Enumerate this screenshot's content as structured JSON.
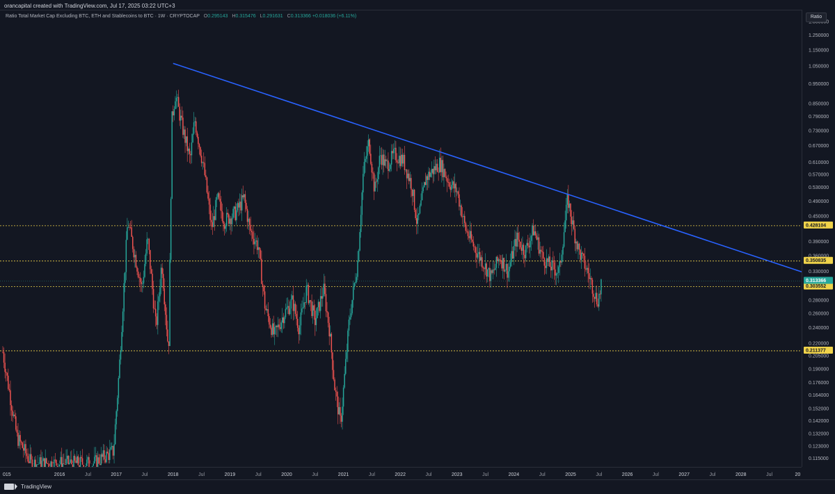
{
  "header": {
    "credit": "orancapital created with TradingView.com, Jul 17, 2025 03:22 UTC+3"
  },
  "legend": {
    "title": "Ratio Total Market Cap Excluding BTC, ETH and Stablecoins to BTC · 1W · CRYPTOCAP",
    "open_label": "O",
    "open": "0.295143",
    "high_label": "H",
    "high": "0.315476",
    "low_label": "L",
    "low": "0.291631",
    "close_label": "C",
    "close": "0.313366",
    "change": "+0.018036 (+6.11%)"
  },
  "price_axis": {
    "scale_button": "Ratio",
    "ticks": [
      "1.350000",
      "1.250000",
      "1.150000",
      "1.050000",
      "0.950000",
      "0.850000",
      "0.790000",
      "0.730000",
      "0.670000",
      "0.610000",
      "0.570000",
      "0.530000",
      "0.490000",
      "0.450000",
      "0.390000",
      "0.360000",
      "0.330000",
      "0.280000",
      "0.260000",
      "0.240000",
      "0.220000",
      "0.205000",
      "0.190000",
      "0.176000",
      "0.164000",
      "0.152000",
      "0.142000",
      "0.132000",
      "0.123000",
      "0.115000"
    ]
  },
  "time_axis": {
    "labels": [
      "015",
      "2016",
      "Jul",
      "2017",
      "Jul",
      "2018",
      "Jul",
      "2019",
      "Jul",
      "2020",
      "Jul",
      "2021",
      "Jul",
      "2022",
      "Jul",
      "2023",
      "Jul",
      "2024",
      "Jul",
      "2025",
      "Jul",
      "2026",
      "Jul",
      "2027",
      "Jul",
      "2028",
      "Jul",
      "20"
    ]
  },
  "footer": {
    "brand": "TradingView"
  },
  "colors": {
    "up": "#26a69a",
    "down": "#ef5350",
    "trendline": "#2962ff",
    "level": "#f0d34a",
    "current": "#26a69a"
  },
  "chart_data": {
    "type": "candlestick",
    "scale": "log",
    "symbol": "Ratio Total Market Cap Excluding BTC, ETH and Stablecoins to BTC",
    "interval": "1W",
    "exchange": "CRYPTOCAP",
    "ylim": [
      0.112,
      1.42
    ],
    "xlim": [
      "2015-01",
      "2029-12"
    ],
    "grid": false,
    "last": {
      "open": 0.295143,
      "high": 0.315476,
      "low": 0.291631,
      "close": 0.313366,
      "change": 0.018036,
      "change_pct": 6.11
    },
    "horizontal_levels": [
      {
        "value": 0.428104,
        "label": "0.428104",
        "style": "dashed"
      },
      {
        "value": 0.350835,
        "label": "0.350835",
        "style": "dashed"
      },
      {
        "value": 0.303552,
        "label": "0.303552",
        "style": "dashed"
      },
      {
        "value": 0.211377,
        "label": "0.211377",
        "style": "dashed"
      }
    ],
    "current_price": {
      "value": 0.313366,
      "label": "0.313366"
    },
    "trendline": {
      "from": {
        "t": 2018.0,
        "y": 1.07
      },
      "to": {
        "t": 2029.6,
        "y": 0.312
      }
    },
    "price_path": [
      [
        2015.0,
        0.21
      ],
      [
        2015.25,
        0.13
      ],
      [
        2015.5,
        0.112
      ],
      [
        2015.8,
        0.112
      ],
      [
        2016.6,
        0.112
      ],
      [
        2016.95,
        0.12
      ],
      [
        2017.05,
        0.19
      ],
      [
        2017.2,
        0.44
      ],
      [
        2017.45,
        0.3
      ],
      [
        2017.55,
        0.4
      ],
      [
        2017.7,
        0.24
      ],
      [
        2017.8,
        0.35
      ],
      [
        2017.92,
        0.21
      ],
      [
        2017.98,
        0.78
      ],
      [
        2018.04,
        0.9
      ],
      [
        2018.15,
        0.76
      ],
      [
        2018.3,
        0.62
      ],
      [
        2018.38,
        0.78
      ],
      [
        2018.55,
        0.58
      ],
      [
        2018.68,
        0.42
      ],
      [
        2018.78,
        0.5
      ],
      [
        2018.9,
        0.44
      ],
      [
        2019.1,
        0.46
      ],
      [
        2019.25,
        0.5
      ],
      [
        2019.35,
        0.42
      ],
      [
        2019.5,
        0.38
      ],
      [
        2019.62,
        0.27
      ],
      [
        2019.78,
        0.23
      ],
      [
        2019.95,
        0.26
      ],
      [
        2020.1,
        0.28
      ],
      [
        2020.22,
        0.24
      ],
      [
        2020.35,
        0.3
      ],
      [
        2020.5,
        0.25
      ],
      [
        2020.65,
        0.3
      ],
      [
        2020.75,
        0.24
      ],
      [
        2020.85,
        0.17
      ],
      [
        2020.95,
        0.14
      ],
      [
        2021.1,
        0.25
      ],
      [
        2021.25,
        0.35
      ],
      [
        2021.35,
        0.58
      ],
      [
        2021.45,
        0.69
      ],
      [
        2021.55,
        0.52
      ],
      [
        2021.65,
        0.64
      ],
      [
        2021.75,
        0.6
      ],
      [
        2021.9,
        0.64
      ],
      [
        2022.05,
        0.62
      ],
      [
        2022.2,
        0.54
      ],
      [
        2022.3,
        0.43
      ],
      [
        2022.45,
        0.56
      ],
      [
        2022.55,
        0.58
      ],
      [
        2022.7,
        0.61
      ],
      [
        2022.85,
        0.55
      ],
      [
        2023.0,
        0.52
      ],
      [
        2023.15,
        0.42
      ],
      [
        2023.3,
        0.38
      ],
      [
        2023.45,
        0.35
      ],
      [
        2023.6,
        0.32
      ],
      [
        2023.75,
        0.36
      ],
      [
        2023.9,
        0.33
      ],
      [
        2024.05,
        0.4
      ],
      [
        2024.2,
        0.37
      ],
      [
        2024.35,
        0.42
      ],
      [
        2024.5,
        0.36
      ],
      [
        2024.65,
        0.34
      ],
      [
        2024.8,
        0.33
      ],
      [
        2024.95,
        0.5
      ],
      [
        2025.05,
        0.42
      ],
      [
        2025.15,
        0.37
      ],
      [
        2025.3,
        0.33
      ],
      [
        2025.4,
        0.3
      ],
      [
        2025.47,
        0.28
      ],
      [
        2025.52,
        0.295
      ],
      [
        2025.54,
        0.313
      ]
    ]
  }
}
